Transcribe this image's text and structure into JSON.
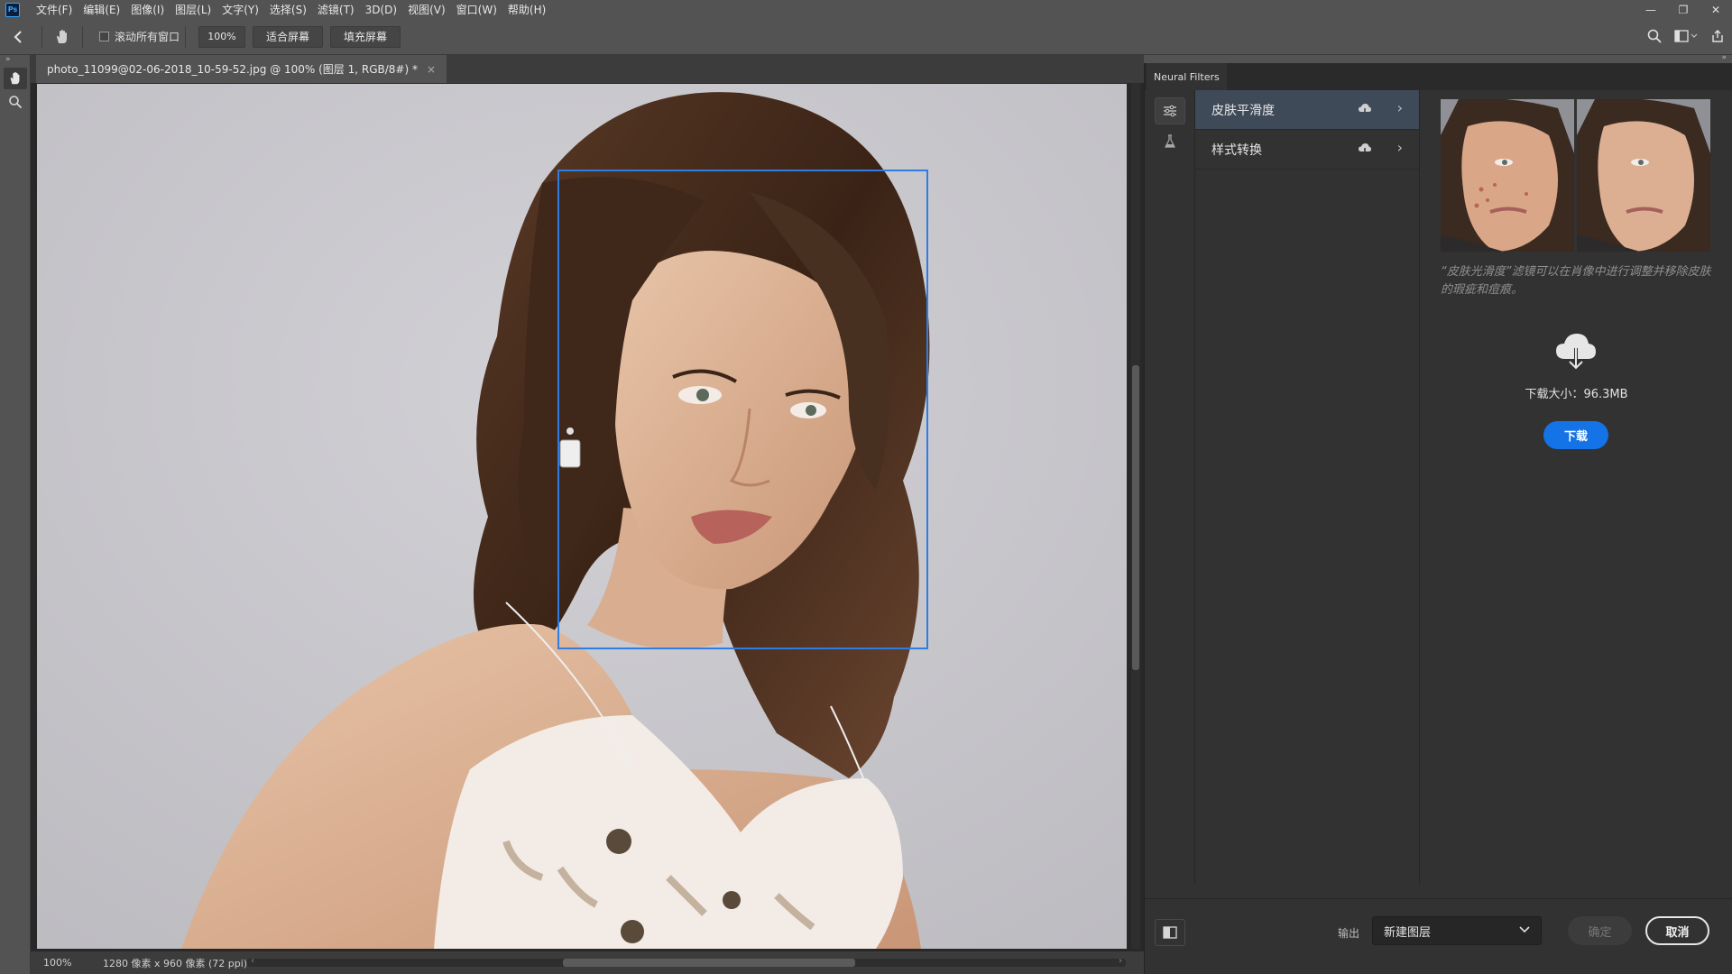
{
  "menubar": {
    "logo": "Ps",
    "items": [
      "文件(F)",
      "编辑(E)",
      "图像(I)",
      "图层(L)",
      "文字(Y)",
      "选择(S)",
      "滤镜(T)",
      "3D(D)",
      "视图(V)",
      "窗口(W)",
      "帮助(H)"
    ],
    "window_controls": [
      "—",
      "❐",
      "✕"
    ]
  },
  "options_bar": {
    "scroll_all_windows": "滚动所有窗口",
    "zoom_value": "100%",
    "fit_screen": "适合屏幕",
    "fill_screen": "填充屏幕"
  },
  "document": {
    "tab_title": "photo_11099@02-06-2018_10-59-52.jpg @ 100% (图层 1, RGB/8#) *",
    "close_glyph": "×"
  },
  "status_bar": {
    "zoom": "100%",
    "info": "1280 像素 x 960 像素 (72 ppi)",
    "arrow": "›",
    "scroll_left": "‹",
    "scroll_right": "›"
  },
  "neural_filters": {
    "tab_label": "Neural Filters",
    "filters": [
      {
        "label": "皮肤平滑度",
        "chevron": "›"
      },
      {
        "label": "样式转换",
        "chevron": "›"
      }
    ],
    "description": "“皮肤光滑度”滤镜可以在肖像中进行调整并移除皮肤的瑕疵和痘痕。",
    "download_size": "下载大小：96.3MB",
    "download_button": "下载",
    "output_label": "输出",
    "output_value": "新建图层",
    "ok_button": "确定",
    "cancel_button": "取消"
  },
  "colors": {
    "accent": "#1473e6",
    "face_box": "#2f7de0",
    "active_filter_bg": "#3f4a58"
  }
}
